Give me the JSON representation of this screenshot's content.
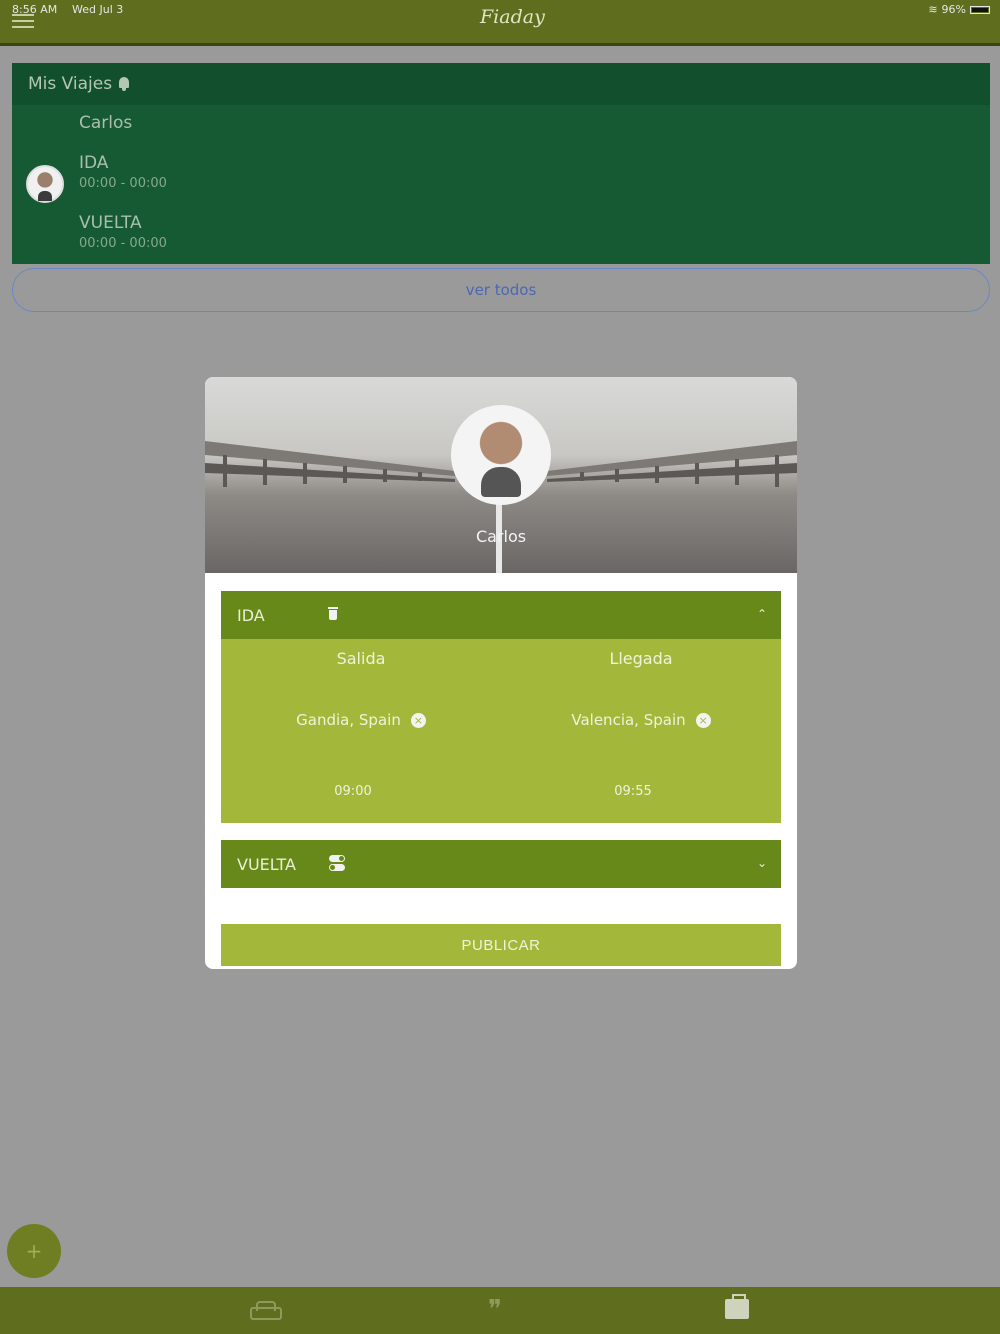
{
  "status_bar": {
    "time": "8:56 AM",
    "date": "Wed Jul 3",
    "battery": "96%"
  },
  "app": {
    "logo": "Fiaday"
  },
  "trips": {
    "header": "Mis Viajes",
    "driver_name": "Carlos",
    "ida_label": "IDA",
    "ida_time": "00:00 - 00:00",
    "vuelta_label": "VUELTA",
    "vuelta_time": "00:00 - 00:00",
    "see_all": "ver todos"
  },
  "modal": {
    "profile_name": "Carlos",
    "ida": {
      "label": "IDA",
      "salida_label": "Salida",
      "llegada_label": "Llegada",
      "salida_place": "Gandia, Spain",
      "llegada_place": "Valencia, Spain",
      "salida_time": "09:00",
      "llegada_time": "09:55"
    },
    "vuelta": {
      "label": "VUELTA"
    },
    "publish_button": "PUBLICAR"
  },
  "fab": {
    "label": "+"
  },
  "bottom_nav": {
    "items": [
      "car-icon",
      "quote-icon",
      "briefcase-icon"
    ]
  },
  "colors": {
    "topbar": "#5f6e1e",
    "trips_card": "#155a33",
    "section_header": "#67891a",
    "section_body": "#a3b83b",
    "link": "#4b67b5"
  }
}
